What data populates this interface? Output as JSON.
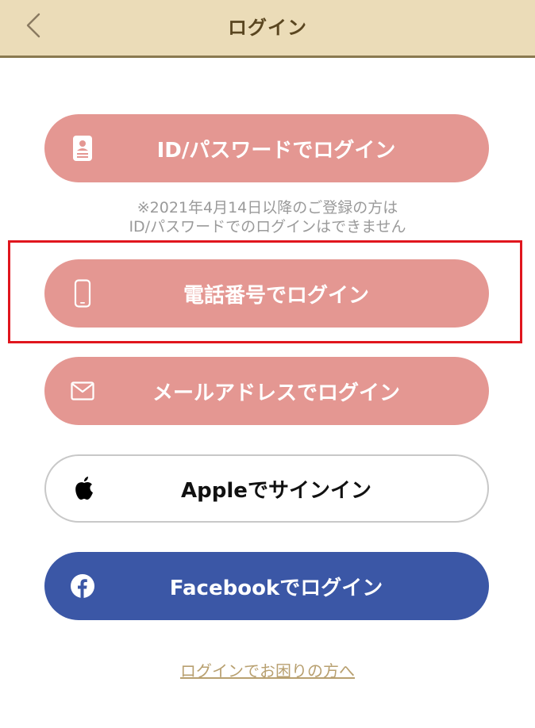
{
  "header": {
    "title": "ログイン",
    "back_icon": "chevron-left-icon"
  },
  "buttons": {
    "id_password": {
      "label": "ID/パスワードでログイン",
      "icon": "id-card-icon"
    },
    "phone": {
      "label": "電話番号でログイン",
      "icon": "smartphone-icon"
    },
    "email": {
      "label": "メールアドレスでログイン",
      "icon": "envelope-icon"
    },
    "apple": {
      "label": "Appleでサインイン",
      "icon": "apple-logo-icon"
    },
    "facebook": {
      "label": "Facebookでログイン",
      "icon": "facebook-logo-icon"
    }
  },
  "note": {
    "line1": "※2021年4月14日以降のご登録の方は",
    "line2": "ID/パスワードでのログインはできません"
  },
  "help_link": "ログインでお困りの方へ",
  "colors": {
    "header_bg": "#ebdcb8",
    "header_text": "#5a4620",
    "pink_button": "#e49792",
    "facebook_blue": "#3b57a6",
    "highlight_red": "#e0161e",
    "link_gold": "#b8a070"
  }
}
